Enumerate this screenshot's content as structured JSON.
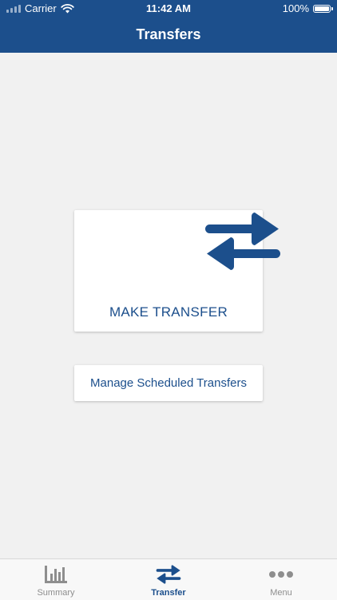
{
  "status_bar": {
    "carrier": "Carrier",
    "time": "11:42 AM",
    "battery": "100%"
  },
  "header": {
    "title": "Transfers",
    "background_color": "#1c4f8c"
  },
  "main": {
    "make_transfer": {
      "label": "MAKE TRANSFER",
      "icon": "transfer-arrows-icon"
    },
    "manage_scheduled": {
      "label": "Manage Scheduled Transfers"
    }
  },
  "tabbar": {
    "active_color": "#1c4f8c",
    "inactive_color": "#8e8e8e",
    "tabs": [
      {
        "label": "Summary",
        "icon": "bar-chart-icon",
        "active": false
      },
      {
        "label": "Transfer",
        "icon": "transfer-arrows-icon",
        "active": true
      },
      {
        "label": "Menu",
        "icon": "more-dots-icon",
        "active": false
      }
    ]
  }
}
